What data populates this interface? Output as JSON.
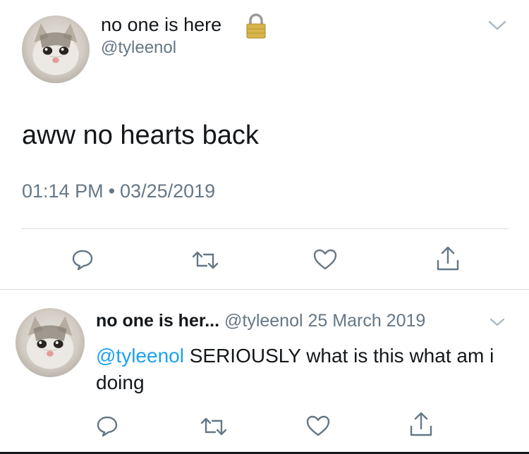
{
  "main_tweet": {
    "display_name": "no one is here",
    "handle": "@tyleenol",
    "text": "aww no hearts back",
    "time": "01:14 PM",
    "separator": "•",
    "date": "03/25/2019",
    "avatar_icon": "crying-cat-avatar",
    "badge_icon": "lock-icon"
  },
  "reply_tweet": {
    "display_name": "no one is her...",
    "handle": "@tyleenol",
    "date": "25 March 2019",
    "mention": "@tyleenol",
    "text": " SERIOUSLY what is this what am i doing",
    "avatar_icon": "crying-cat-avatar"
  },
  "actions": [
    "reply-icon",
    "retweet-icon",
    "like-icon",
    "share-icon"
  ],
  "colors": {
    "text": "#14171a",
    "secondary": "#657786",
    "link": "#1da1f2",
    "divider": "#d9dde1"
  }
}
